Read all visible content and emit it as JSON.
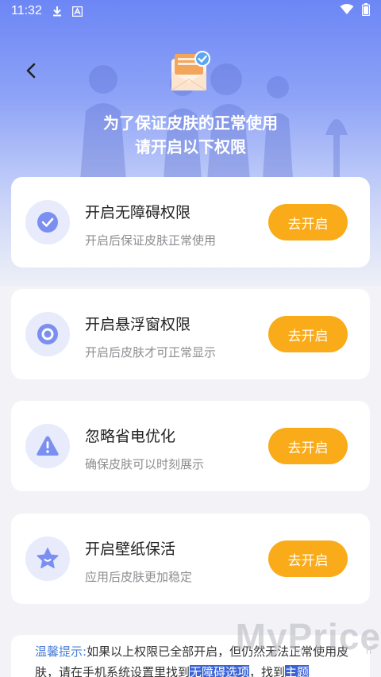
{
  "status_bar": {
    "time": "11:32",
    "icons": [
      "download-icon",
      "app-a-icon",
      "wifi-icon",
      "battery-icon"
    ]
  },
  "header": {
    "title_line1": "为了保证皮肤的正常使用",
    "title_line2": "请开启以下权限",
    "back_icon": "chevron-left-icon"
  },
  "permissions": [
    {
      "title": "开启无障碍权限",
      "subtitle": "开启后保证皮肤正常使用",
      "button": "去开启",
      "icon": "check-circle-icon"
    },
    {
      "title": "开启悬浮窗权限",
      "subtitle": "开启后皮肤才可正常显示",
      "button": "去开启",
      "icon": "ring-icon"
    },
    {
      "title": "忽略省电优化",
      "subtitle": "确保皮肤可以时刻展示",
      "button": "去开启",
      "icon": "warning-triangle-icon"
    },
    {
      "title": "开启壁纸保活",
      "subtitle": "应用后皮肤更加稳定",
      "button": "去开启",
      "icon": "star-smile-icon"
    }
  ],
  "tip": {
    "label": "温馨提示:",
    "text1": "如果以上权限已全部开启，但仍然无法正常使用皮肤，请在手机系统设置里找到",
    "highlight1": "无障碍选项",
    "text2": "，找到",
    "highlight2": "主题"
  },
  "watermark": "MyPrice",
  "watermark_small": "o m . c n",
  "colors": {
    "accent": "#6c86f5",
    "button": "#f9ab19",
    "icon": "#7b8ff0"
  }
}
